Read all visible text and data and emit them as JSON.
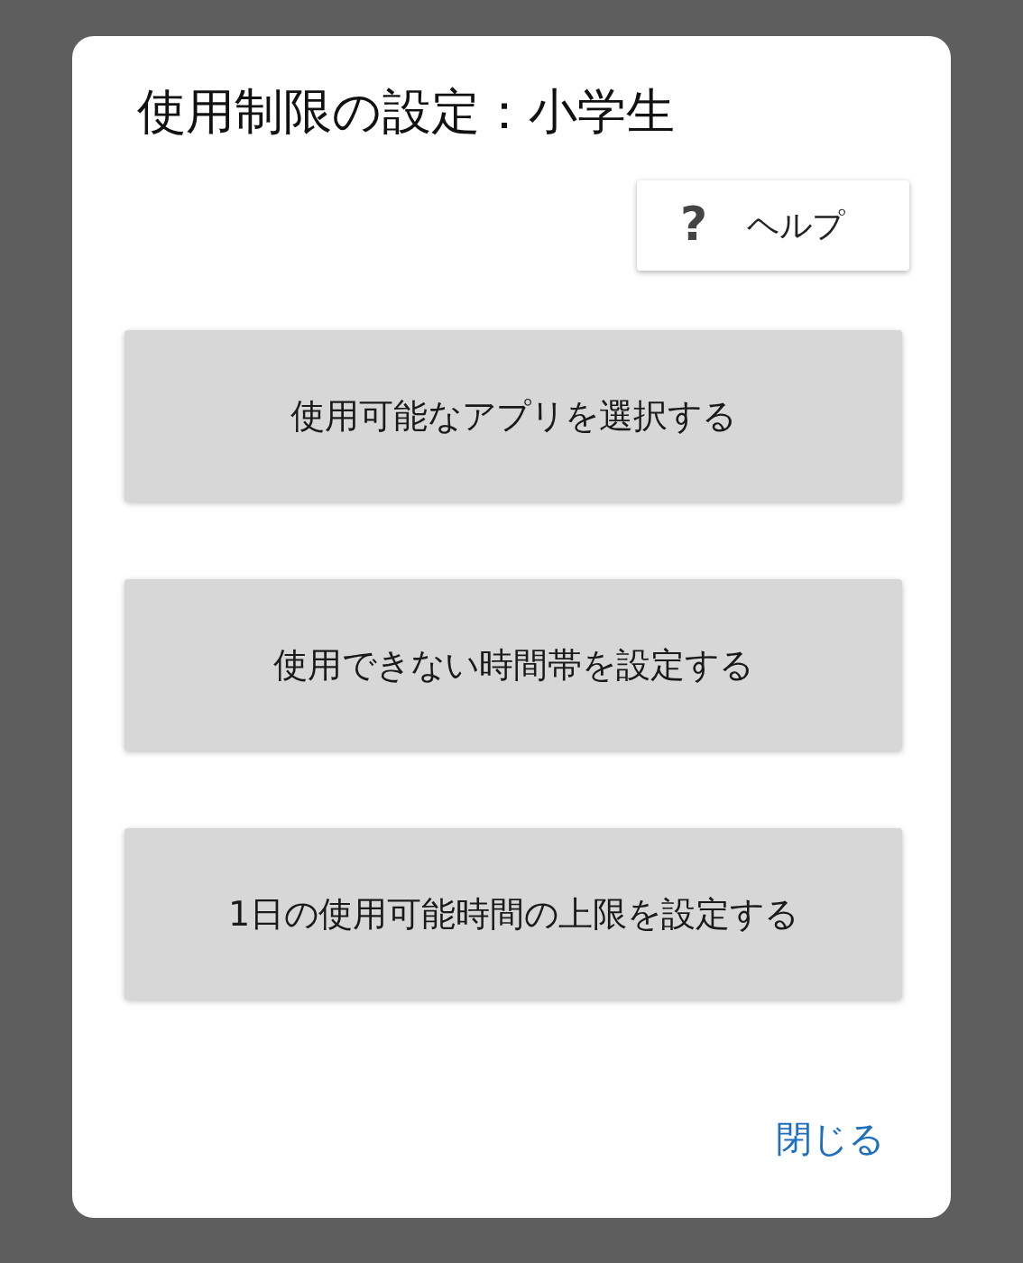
{
  "dialog": {
    "title": "使用制限の設定：小学生",
    "help_button": {
      "icon": "?",
      "label": "ヘルプ"
    },
    "options": [
      {
        "label": "使用可能なアプリを選択する"
      },
      {
        "label": "使用できない時間帯を設定する"
      },
      {
        "label": "1日の使用可能時間の上限を設定する"
      }
    ],
    "close_link": "閉じる"
  }
}
